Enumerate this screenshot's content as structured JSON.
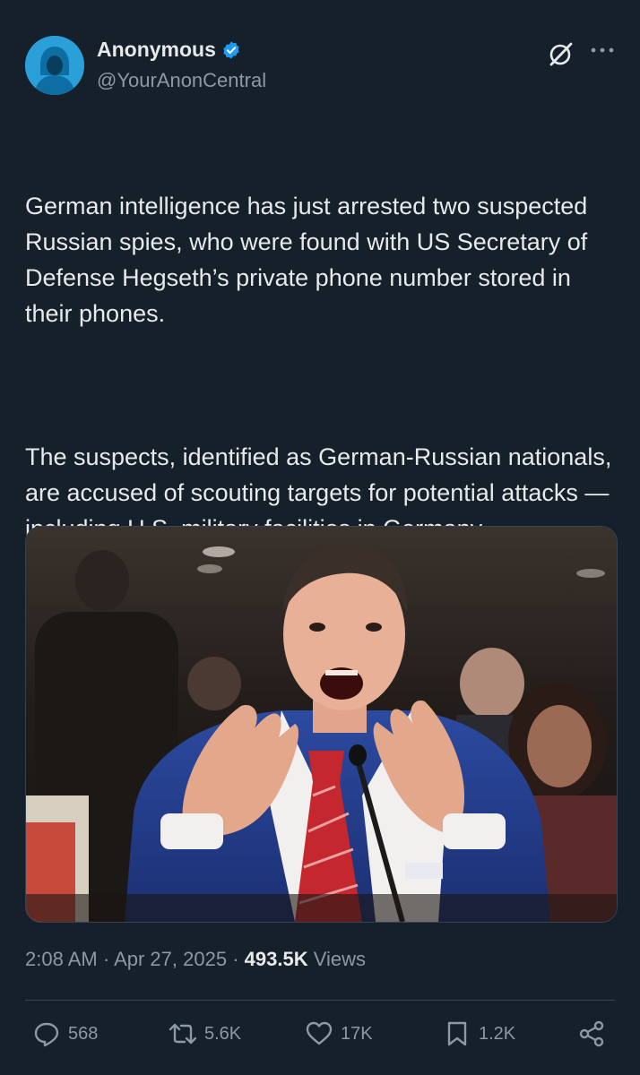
{
  "author": {
    "name": "Anonymous",
    "handle": "@YourAnonCentral",
    "verified": true,
    "avatar_icon": "hooded-figure-avatar"
  },
  "header_icons": [
    "grok-icon",
    "more-icon"
  ],
  "tweet": {
    "paragraph_1": "German intelligence has just arrested two suspected Russian spies, who were found with US Secretary of Defense Hegseth’s private phone number stored in their phones.",
    "paragraph_2": "The suspects, identified as German-Russian nationals, are accused of scouting targets for potential attacks — including U.S. military facilities in Germany — according to a statement released Thursday by the Federal Public Prosecutor General in Karlsruhe."
  },
  "meta": {
    "time": "2:08 AM",
    "separator": "·",
    "date": "Apr 27, 2025",
    "views_count": "493.5K",
    "views_label": "Views"
  },
  "actions": {
    "replies": "568",
    "reposts": "5.6K",
    "likes": "17K",
    "bookmarks": "1.2K"
  },
  "colors": {
    "background": "#15202b",
    "text": "#e7e9ea",
    "muted": "#8b98a5",
    "accent": "#1d9bf0"
  }
}
